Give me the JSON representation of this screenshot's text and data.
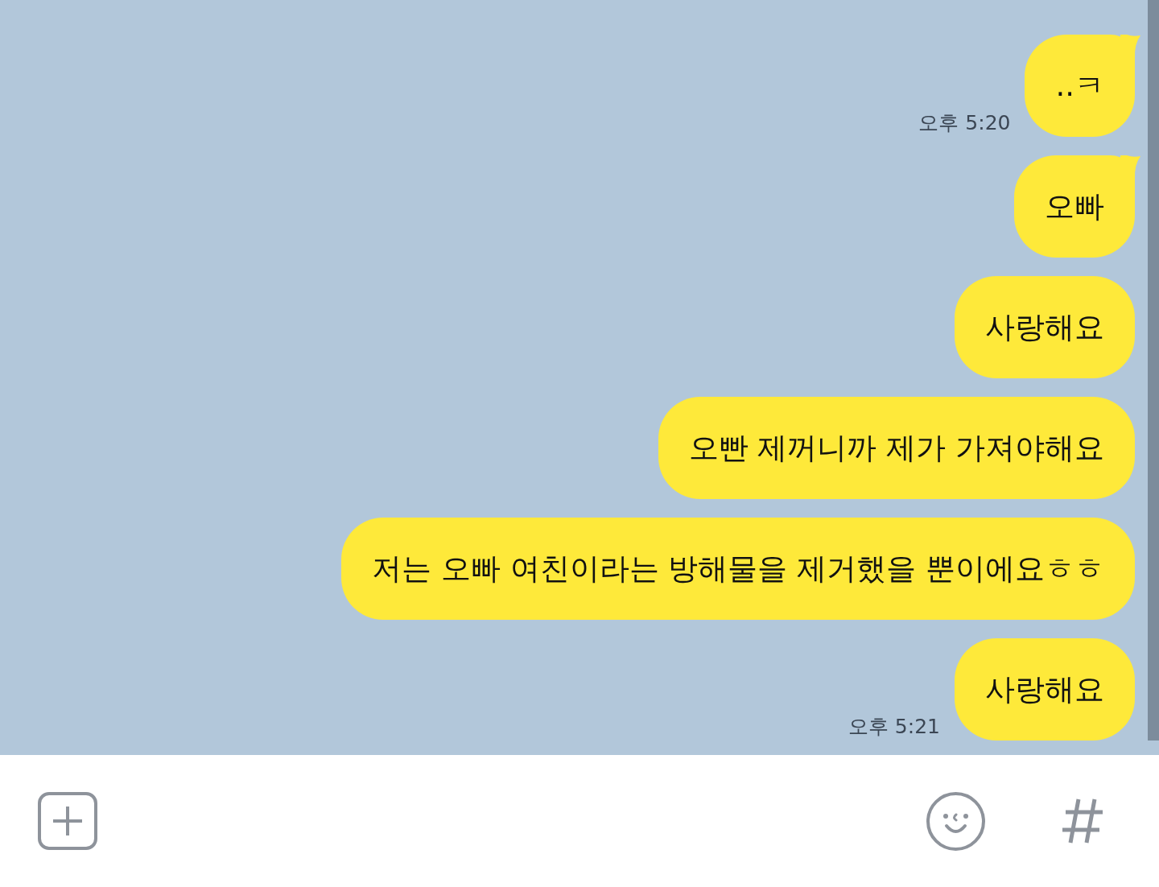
{
  "messages": [
    {
      "text": "..ㅋ",
      "tail": true,
      "time": "오후 5:20"
    },
    {
      "text": "오빠",
      "tail": true
    },
    {
      "text": "사랑해요",
      "tail": false
    },
    {
      "text": "오빤 제꺼니까 제가 가져야해요",
      "tail": false
    },
    {
      "text": "저는 오빠 여친이라는 방해물을 제거했을 뿐이에요ㅎㅎ",
      "tail": false
    },
    {
      "text": "사랑해요",
      "tail": false,
      "time": "오후 5:21"
    }
  ]
}
